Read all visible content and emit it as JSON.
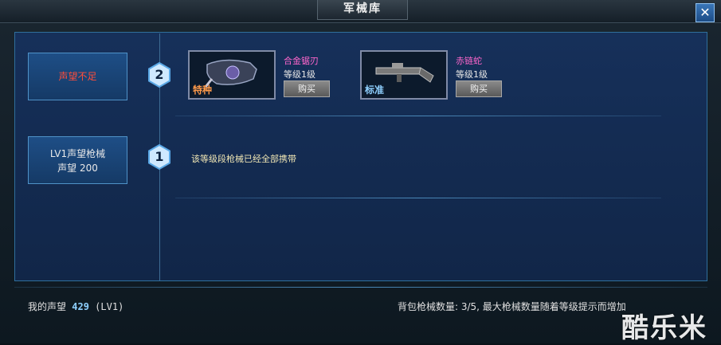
{
  "window": {
    "title": "军械库",
    "close_glyph": "✕"
  },
  "tiers": [
    {
      "number": "2",
      "label": "声望不足",
      "label_color": "#ff4d3a",
      "weapons": [
        {
          "name": "合金锯刃",
          "level": "等级1级",
          "tag": "特种",
          "tag_color": "#ff9a4a",
          "buy_label": "购买",
          "icon": "saw-blade-gun-icon"
        },
        {
          "name": "赤链蛇",
          "level": "等级1级",
          "tag": "标准",
          "tag_color": "#8fd0ff",
          "buy_label": "购买",
          "icon": "rifle-icon"
        }
      ]
    },
    {
      "number": "1",
      "label_line1": "LV1声望枪械",
      "label_line2": "声望 200",
      "message": "该等级段枪械已经全部携带"
    }
  ],
  "footer": {
    "reputation_label": "我的声望",
    "reputation_value": "429",
    "reputation_level": "(LV1)",
    "backpack_info": "背包枪械数量: 3/5, 最大枪械数量随着等级提示而增加"
  },
  "watermark": "酷乐米",
  "colors": {
    "panel": "#16305a",
    "accent": "#4f92c8",
    "weapon_name": "#ff66cc"
  }
}
